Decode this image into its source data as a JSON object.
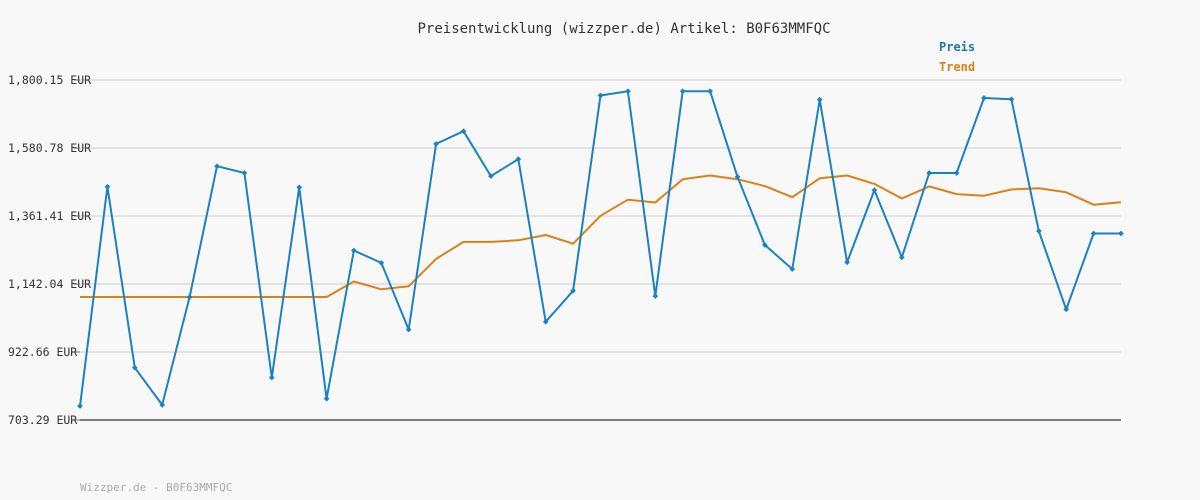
{
  "chart_data": {
    "type": "line",
    "title": "Preisentwicklung (wizzper.de) Artikel: B0F63MMFQC",
    "xlabel": "",
    "ylabel": "",
    "ylim": [
      703.29,
      1800.15
    ],
    "yticks": [
      "703.29 EUR",
      "922.66 EUR",
      "1,142.04 EUR",
      "1,361.41 EUR",
      "1,580.78 EUR",
      "1,800.15 EUR"
    ],
    "ytick_values": [
      703.29,
      922.66,
      1142.04,
      1361.41,
      1580.78,
      1800.15
    ],
    "grid": true,
    "legend_position": "top-right",
    "series": [
      {
        "name": "Preis",
        "color": "#1a82c2",
        "markers": true,
        "values": [
          748,
          1456,
          872,
          752,
          1100,
          1522,
          1500,
          840,
          1454,
          772,
          1250,
          1210,
          995,
          1594,
          1635,
          1490,
          1545,
          1020,
          1120,
          1750,
          1764,
          1103,
          1764,
          1764,
          1488,
          1268,
          1190,
          1737,
          1212,
          1445,
          1228,
          1500,
          1500,
          1742,
          1738,
          1313,
          1060,
          1305,
          1305
        ]
      },
      {
        "name": "Trend",
        "color": "#d98219",
        "markers": false,
        "values": [
          1100,
          1100,
          1100,
          1100,
          1100,
          1100,
          1100,
          1100,
          1100,
          1100,
          1150,
          1125,
          1135,
          1223,
          1278,
          1278,
          1283,
          1300,
          1272,
          1362,
          1414,
          1405,
          1480,
          1492,
          1480,
          1458,
          1422,
          1483,
          1492,
          1465,
          1418,
          1457,
          1432,
          1427,
          1447,
          1451,
          1438,
          1398,
          1406
        ]
      }
    ]
  },
  "footer": "Wizzper.de - B0F63MMFQC"
}
